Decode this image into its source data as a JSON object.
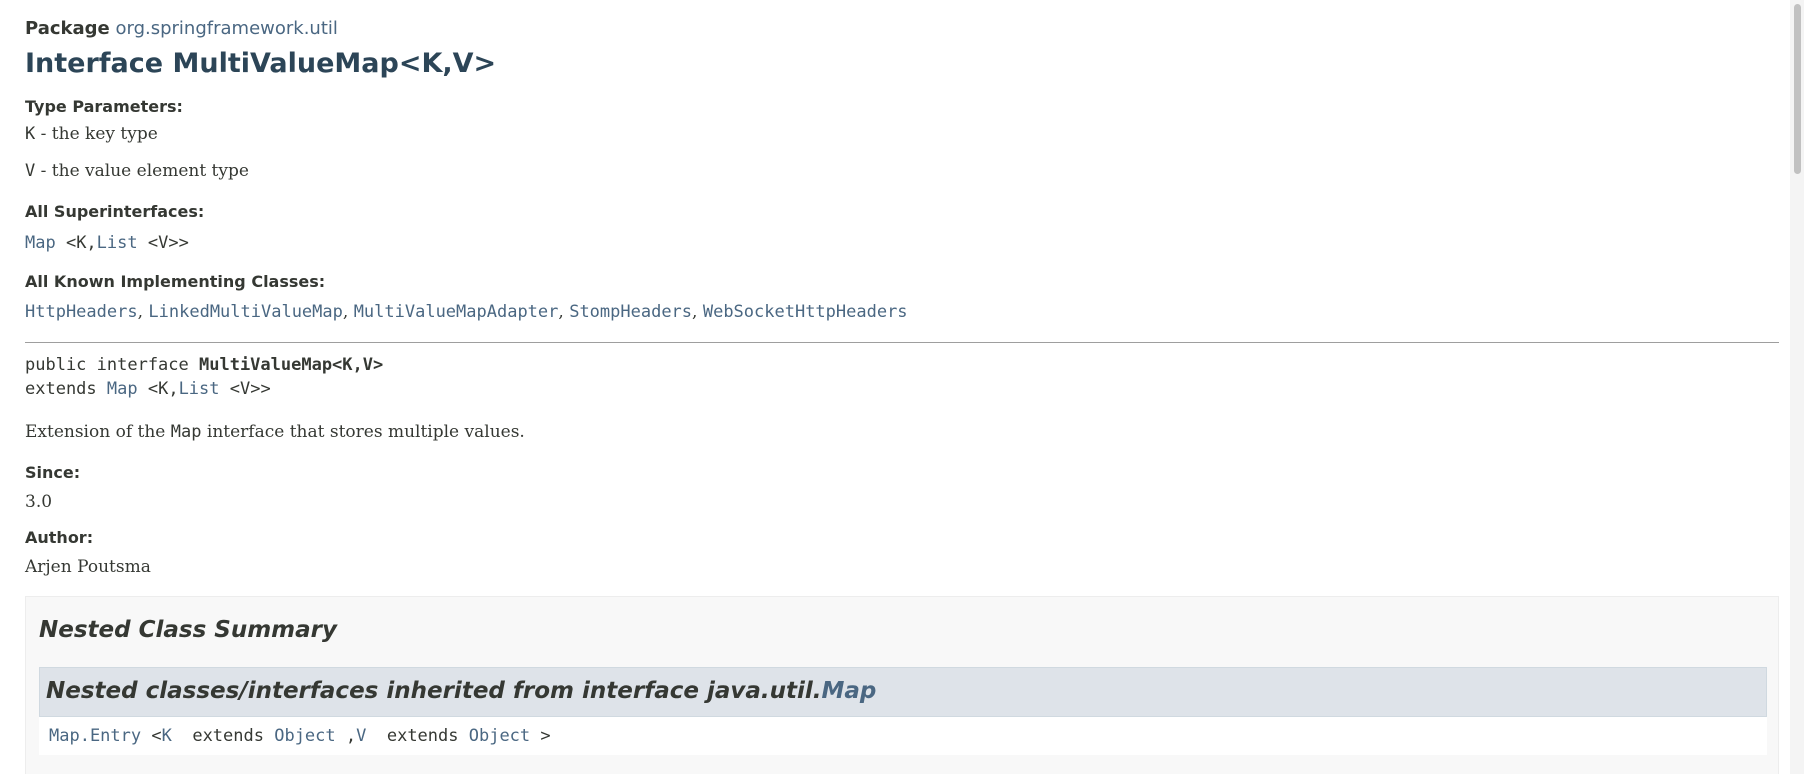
{
  "package": {
    "label": "Package",
    "name": "org.springframework.util"
  },
  "title": "Interface MultiValueMap<K,V>",
  "type_parameters": {
    "heading": "Type Parameters:",
    "items": [
      {
        "name": "K",
        "desc": " - the key type"
      },
      {
        "name": "V",
        "desc": " - the value element type"
      }
    ]
  },
  "superinterfaces": {
    "heading": "All Superinterfaces:",
    "map": "Map",
    "mid": " <K,",
    "list": "List",
    "end": " <V>>"
  },
  "implementing": {
    "heading": "All Known Implementing Classes:",
    "classes": [
      "HttpHeaders",
      "LinkedMultiValueMap",
      "MultiValueMapAdapter",
      "StompHeaders",
      "WebSocketHttpHeaders"
    ],
    "separator": ", "
  },
  "signature": {
    "prefix": "public interface ",
    "name": "MultiValueMap<K,V>",
    "extends_label": "extends ",
    "map": "Map",
    "mid": " <K,",
    "list": "List",
    "end": " <V>>"
  },
  "description": {
    "before": "Extension of the ",
    "code": "Map",
    "after": " interface that stores multiple values."
  },
  "since": {
    "heading": "Since:",
    "value": "3.0"
  },
  "author": {
    "heading": "Author:",
    "value": "Arjen Poutsma"
  },
  "nested_summary": {
    "title": "Nested Class Summary",
    "inherited_prefix": "Nested classes/interfaces inherited from interface java.util.",
    "inherited_link": "Map",
    "entry_link": "Map.Entry",
    "entry_lt": " <",
    "entry_k": "K",
    "entry_ext1": "  extends ",
    "entry_obj1": "Object",
    "entry_comma": " ,",
    "entry_v": "V",
    "entry_ext2": "  extends ",
    "entry_obj2": "Object",
    "entry_gt": " >"
  }
}
